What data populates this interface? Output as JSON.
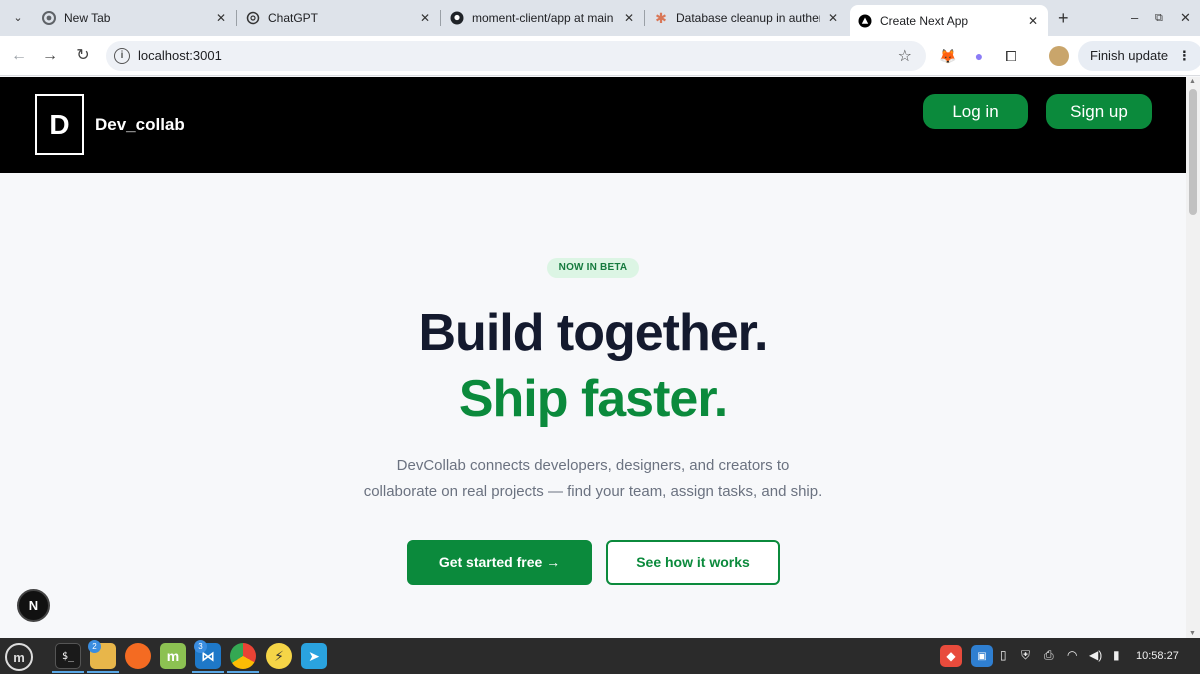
{
  "browser": {
    "tabs": [
      {
        "title": "New Tab",
        "icon": "chrome-icon"
      },
      {
        "title": "ChatGPT",
        "icon": "chatgpt-icon"
      },
      {
        "title": "moment-client/app at main",
        "icon": "github-icon"
      },
      {
        "title": "Database cleanup in authen",
        "icon": "claude-icon"
      },
      {
        "title": "Create Next App",
        "icon": "nextjs-icon",
        "active": true
      }
    ],
    "url": "localhost:3001",
    "finish_update_label": "Finish update"
  },
  "site": {
    "logo_letter": "D",
    "brand": "Dev_collab",
    "login_label": "Log in",
    "signup_label": "Sign up",
    "badge": "NOW IN BETA",
    "headline_line1": "Build together.",
    "headline_line2": "Ship faster.",
    "subtext_line1": "DevCollab connects developers, designers, and creators to",
    "subtext_line2": "collaborate on real projects — find your team, assign tasks, and ship.",
    "cta_primary": "Get started free →",
    "cta_secondary": "See how it works",
    "dev_indicator": "N"
  },
  "taskbar": {
    "badges": {
      "files": "2",
      "vscode": "3"
    },
    "clock": "10:58:27"
  },
  "colors": {
    "brand_green": "#0b8a3c",
    "header_bg": "#000000",
    "headline_dark": "#141a2e",
    "page_bg": "#f7f8fa"
  }
}
